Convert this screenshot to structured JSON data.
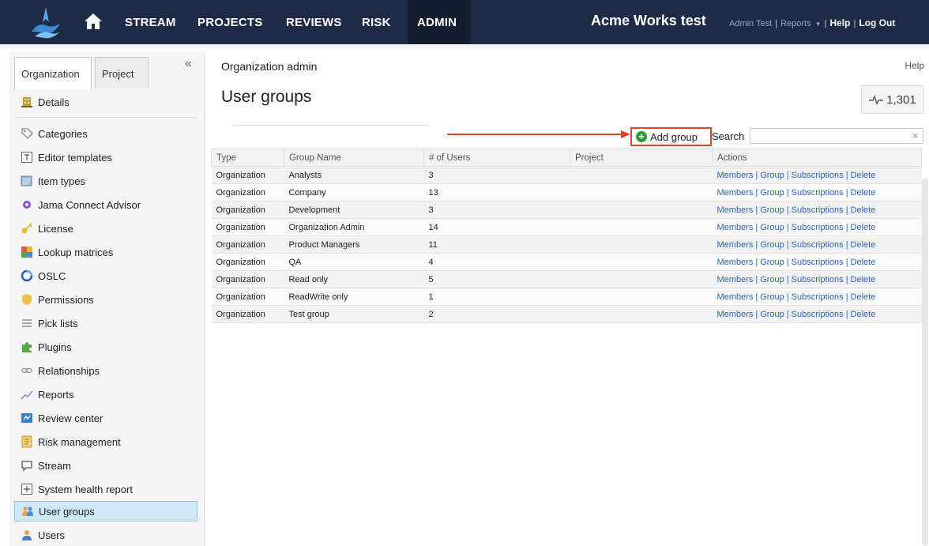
{
  "nav": {
    "items": [
      "STREAM",
      "PROJECTS",
      "REVIEWS",
      "RISK",
      "ADMIN"
    ],
    "app_title": "Acme Works test",
    "user": "Admin Test",
    "reports": "Reports",
    "help": "Help",
    "logout": "Log Out",
    "sep": "|"
  },
  "sidebar": {
    "tabs": [
      "Organization",
      "Project"
    ],
    "collapse": "«",
    "items": [
      {
        "label": "Details",
        "icon": "building-icon"
      },
      {
        "label": "Categories",
        "icon": "tag-icon"
      },
      {
        "label": "Editor templates",
        "icon": "template-icon"
      },
      {
        "label": "Item types",
        "icon": "item-types-icon"
      },
      {
        "label": "Jama Connect Advisor",
        "icon": "advisor-icon"
      },
      {
        "label": "License",
        "icon": "key-icon"
      },
      {
        "label": "Lookup matrices",
        "icon": "matrix-icon"
      },
      {
        "label": "OSLC",
        "icon": "oslc-icon"
      },
      {
        "label": "Permissions",
        "icon": "shield-icon"
      },
      {
        "label": "Pick lists",
        "icon": "list-icon"
      },
      {
        "label": "Plugins",
        "icon": "puzzle-icon"
      },
      {
        "label": "Relationships",
        "icon": "link-icon"
      },
      {
        "label": "Reports",
        "icon": "chart-icon"
      },
      {
        "label": "Review center",
        "icon": "review-icon"
      },
      {
        "label": "Risk management",
        "icon": "risk-icon"
      },
      {
        "label": "Stream",
        "icon": "chat-icon"
      },
      {
        "label": "System health report",
        "icon": "health-icon"
      },
      {
        "label": "User groups",
        "icon": "users-group-icon"
      },
      {
        "label": "Users",
        "icon": "user-icon"
      }
    ],
    "selected": "User groups"
  },
  "main": {
    "breadcrumb": "Organization admin",
    "help": "Help",
    "title": "User groups",
    "counter": "1,301",
    "add_group": "Add group",
    "search_label": "Search",
    "search_value": "",
    "search_clear": "×",
    "columns": [
      "Type",
      "Group Name",
      "# of Users",
      "Project",
      "Actions"
    ],
    "action_labels": [
      "Members",
      "Group",
      "Subscriptions",
      "Delete"
    ],
    "rows": [
      {
        "type": "Organization",
        "name": "Analysts",
        "users": "3",
        "project": ""
      },
      {
        "type": "Organization",
        "name": "Company",
        "users": "13",
        "project": ""
      },
      {
        "type": "Organization",
        "name": "Development",
        "users": "3",
        "project": ""
      },
      {
        "type": "Organization",
        "name": "Organization Admin",
        "users": "14",
        "project": ""
      },
      {
        "type": "Organization",
        "name": "Product Managers",
        "users": "11",
        "project": ""
      },
      {
        "type": "Organization",
        "name": "QA",
        "users": "4",
        "project": ""
      },
      {
        "type": "Organization",
        "name": "Read only",
        "users": "5",
        "project": ""
      },
      {
        "type": "Organization",
        "name": "ReadWrite only",
        "users": "1",
        "project": ""
      },
      {
        "type": "Organization",
        "name": "Test group",
        "users": "2",
        "project": ""
      }
    ]
  },
  "colors": {
    "nav_bg": "#1e2b47",
    "highlight": "#e0442a",
    "link": "#2b65c7",
    "selected_bg": "#cfe7f7"
  }
}
